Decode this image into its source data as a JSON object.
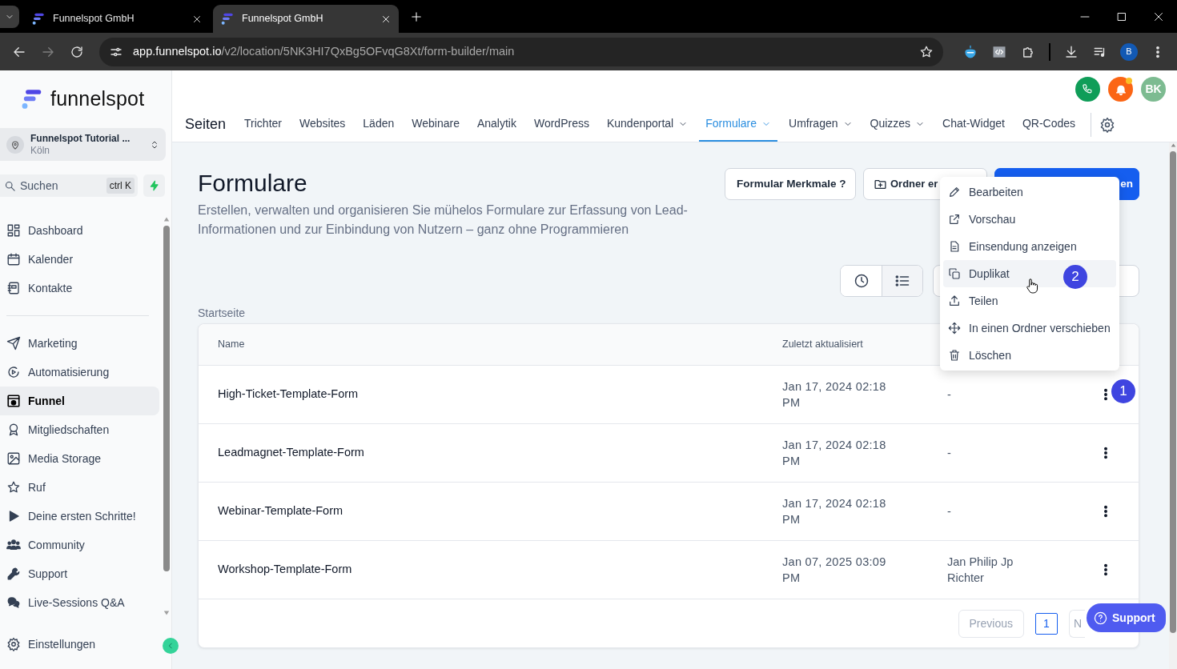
{
  "browser": {
    "tabs": [
      {
        "title": "Funnelspot GmbH",
        "selected": false
      },
      {
        "title": "Funnelspot GmbH",
        "selected": true
      }
    ],
    "url": {
      "host": "app.funnelspot.io",
      "path": "/v2/location/5NK3HI7QxBg5OFvqG8Xt/form-builder/main"
    },
    "profile": "B"
  },
  "sidebar": {
    "brand": "funnelspot",
    "account": {
      "name": "Funnelspot Tutorial ...",
      "location": "Köln"
    },
    "search": {
      "placeholder": "Suchen",
      "shortcut": "ctrl K"
    },
    "groups": [
      [
        {
          "label": "Dashboard",
          "selected": false
        },
        {
          "label": "Kalender",
          "selected": false
        },
        {
          "label": "Kontakte",
          "selected": false
        }
      ],
      [
        {
          "label": "Marketing",
          "selected": false
        },
        {
          "label": "Automatisierung",
          "selected": false
        },
        {
          "label": "Funnel",
          "selected": true
        },
        {
          "label": "Mitgliedschaften",
          "selected": false
        },
        {
          "label": "Media Storage",
          "selected": false
        },
        {
          "label": "Ruf",
          "selected": false
        },
        {
          "label": "Deine ersten Schritte!",
          "selected": false
        },
        {
          "label": "Community",
          "selected": false
        },
        {
          "label": "Support",
          "selected": false
        },
        {
          "label": "Live-Sessions Q&A",
          "selected": false
        }
      ]
    ],
    "settings": "Einstellungen"
  },
  "header": {
    "avatar": "BK",
    "unread": true,
    "section": "Seiten",
    "tabs": [
      {
        "label": "Trichter",
        "selected": false,
        "dropdown": false
      },
      {
        "label": "Websites",
        "selected": false,
        "dropdown": false
      },
      {
        "label": "Läden",
        "selected": false,
        "dropdown": false
      },
      {
        "label": "Webinare",
        "selected": false,
        "dropdown": false
      },
      {
        "label": "Analytik",
        "selected": false,
        "dropdown": false
      },
      {
        "label": "WordPress",
        "selected": false,
        "dropdown": false
      },
      {
        "label": "Kundenportal",
        "selected": false,
        "dropdown": true
      },
      {
        "label": "Formulare",
        "selected": true,
        "dropdown": true
      },
      {
        "label": "Umfragen",
        "selected": false,
        "dropdown": true
      },
      {
        "label": "Quizzes",
        "selected": false,
        "dropdown": true
      },
      {
        "label": "Chat-Widget",
        "selected": false,
        "dropdown": false
      },
      {
        "label": "QR-Codes",
        "selected": false,
        "dropdown": false
      }
    ]
  },
  "page": {
    "title": "Formulare",
    "subtitle": "Erstellen, verwalten und organisieren Sie mühelos Formulare zur Erfassung von Lead-Informationen und zur Einbindung von Nutzern – ganz ohne Programmieren",
    "buttons": [
      {
        "kind": "outline",
        "label": "Formular Merkmale ?"
      },
      {
        "kind": "folder",
        "label": "Ordner er"
      },
      {
        "kind": "primary",
        "label": "en"
      }
    ],
    "views": [
      {
        "kind": "recent",
        "selected": false
      },
      {
        "kind": "list",
        "selected": true
      }
    ],
    "breadcrumb": "Startseite",
    "table": {
      "columns": [
        "Name",
        "Zuletzt aktualisiert"
      ],
      "rows": [
        {
          "name": "High-Ticket-Template-Form",
          "updated": "Jan 17, 2024 02:18 PM",
          "column_3": "-",
          "step_marker": "1"
        },
        {
          "name": "Leadmagnet-Template-Form",
          "updated": "Jan 17, 2024 02:18 PM",
          "column_3": "-"
        },
        {
          "name": "Webinar-Template-Form",
          "updated": "Jan 17, 2024 02:18 PM",
          "column_3": "-"
        },
        {
          "name": "Workshop-Template-Form",
          "updated": "Jan 07, 2025 03:09 PM",
          "column_3": "Jan Philip Jp Richter"
        }
      ]
    },
    "pagination": {
      "previous": "Previous",
      "pages": [
        {
          "label": "1",
          "selected": true
        }
      ],
      "next": "N"
    }
  },
  "context_menu": {
    "items": [
      {
        "label": "Bearbeiten",
        "highlighted": false
      },
      {
        "label": "Vorschau",
        "highlighted": false
      },
      {
        "label": "Einsendung anzeigen",
        "highlighted": false
      },
      {
        "label": "Duplikat",
        "highlighted": true,
        "step_marker": "2"
      },
      {
        "label": "Teilen",
        "highlighted": false
      },
      {
        "label": "In einen Ordner verschieben",
        "highlighted": false
      },
      {
        "label": "Löschen",
        "highlighted": false
      }
    ]
  },
  "support_button": "Support"
}
